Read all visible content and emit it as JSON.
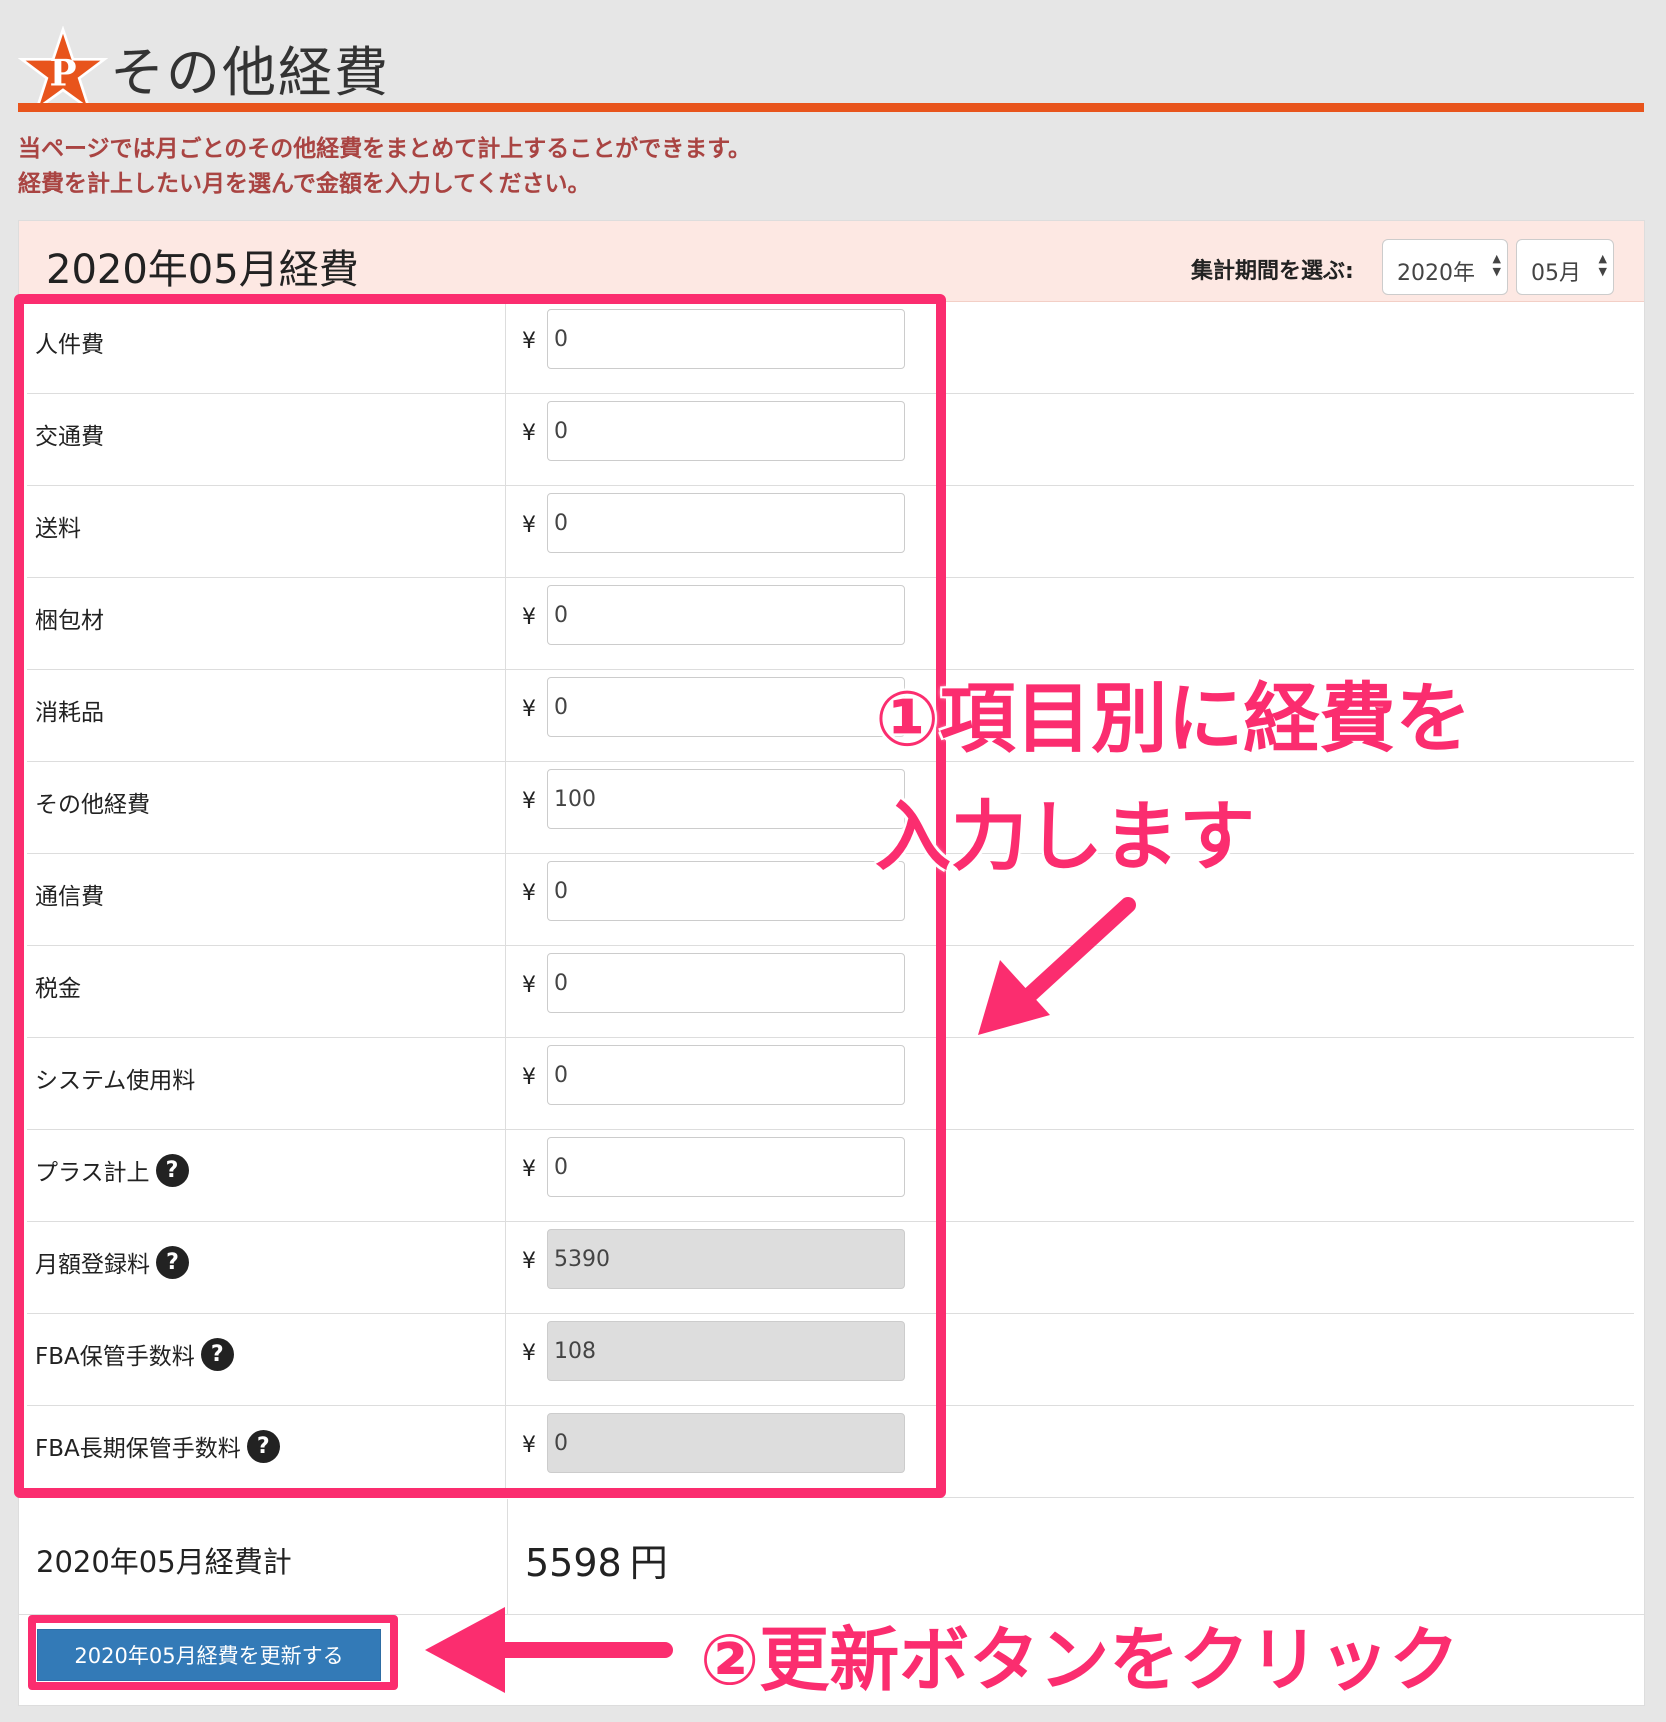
{
  "header": {
    "logo_letter": "P",
    "title": "その他経費",
    "accent_color": "#e8541c"
  },
  "intro": {
    "line1": "当ページでは月ごとのその他経費をまとめて計上することができます。",
    "line2": "経費を計上したい月を選んで金額を入力してください。"
  },
  "panel": {
    "title": "2020年05月経費",
    "period_label": "集計期間を選ぶ:",
    "year_select": "2020年",
    "month_select": "05月"
  },
  "currency_symbol": "¥",
  "help_icon_glyph": "?",
  "expenses": [
    {
      "label": "人件費",
      "value": "0"
    },
    {
      "label": "交通費",
      "value": "0"
    },
    {
      "label": "送料",
      "value": "0"
    },
    {
      "label": "梱包材",
      "value": "0"
    },
    {
      "label": "消耗品",
      "value": "0"
    },
    {
      "label": "その他経費",
      "value": "100"
    },
    {
      "label": "通信費",
      "value": "0"
    },
    {
      "label": "税金",
      "value": "0"
    },
    {
      "label": "システム使用料",
      "value": "0"
    },
    {
      "label": "プラス計上",
      "value": "0",
      "help": true
    },
    {
      "label": "月額登録料",
      "value": "5390",
      "help": true,
      "disabled": true
    },
    {
      "label": "FBA保管手数料",
      "value": "108",
      "help": true,
      "disabled": true
    },
    {
      "label": "FBA長期保管手数料",
      "value": "0",
      "help": true,
      "disabled": true
    }
  ],
  "total": {
    "label": "2020年05月経費計",
    "value": "5598",
    "unit": "円"
  },
  "update_button": "2020年05月経費を更新する",
  "annotations": {
    "note1_line1": "①項目別に経費を",
    "note1_line2": "入力します",
    "note2": "②更新ボタンをクリック",
    "color": "#fb2d6f"
  }
}
